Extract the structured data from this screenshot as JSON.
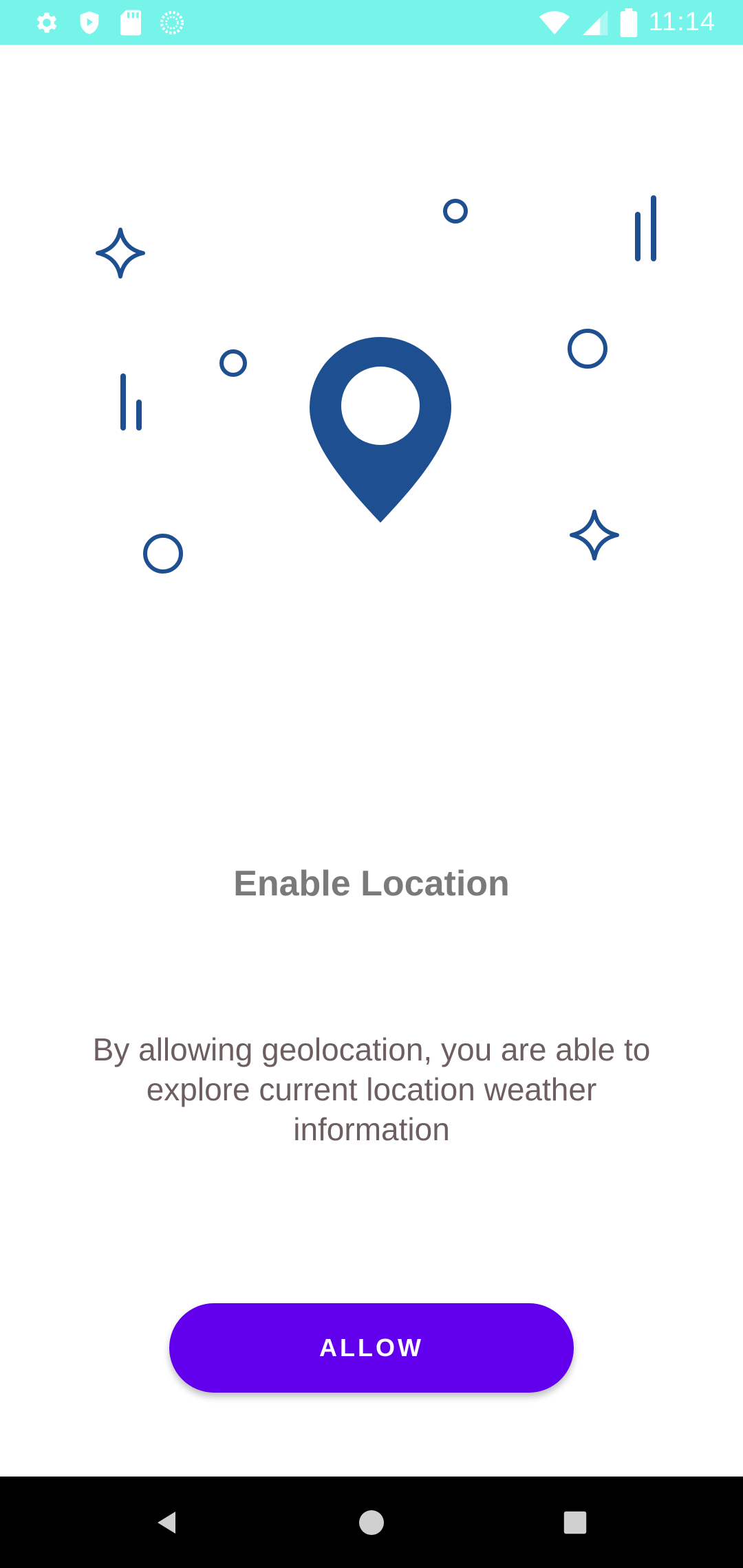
{
  "status_bar": {
    "time": "11:14",
    "background": "#76F4EA",
    "left_icons": [
      "settings-icon",
      "shield-play-icon",
      "sd-card-icon",
      "sync-circle-icon"
    ],
    "right_icons": [
      "wifi-icon",
      "signal-icon",
      "battery-icon"
    ]
  },
  "illustration": {
    "accent_color": "#1E5091",
    "main_icon": "location-pin-icon"
  },
  "content": {
    "title": "Enable Location",
    "description": "By allowing geolocation, you are able to explore current location weather information"
  },
  "actions": {
    "allow_label": "ALLOW",
    "button_color": "#6200EE"
  },
  "nav_bar": {
    "buttons": [
      "back-icon",
      "home-icon",
      "recents-icon"
    ]
  }
}
